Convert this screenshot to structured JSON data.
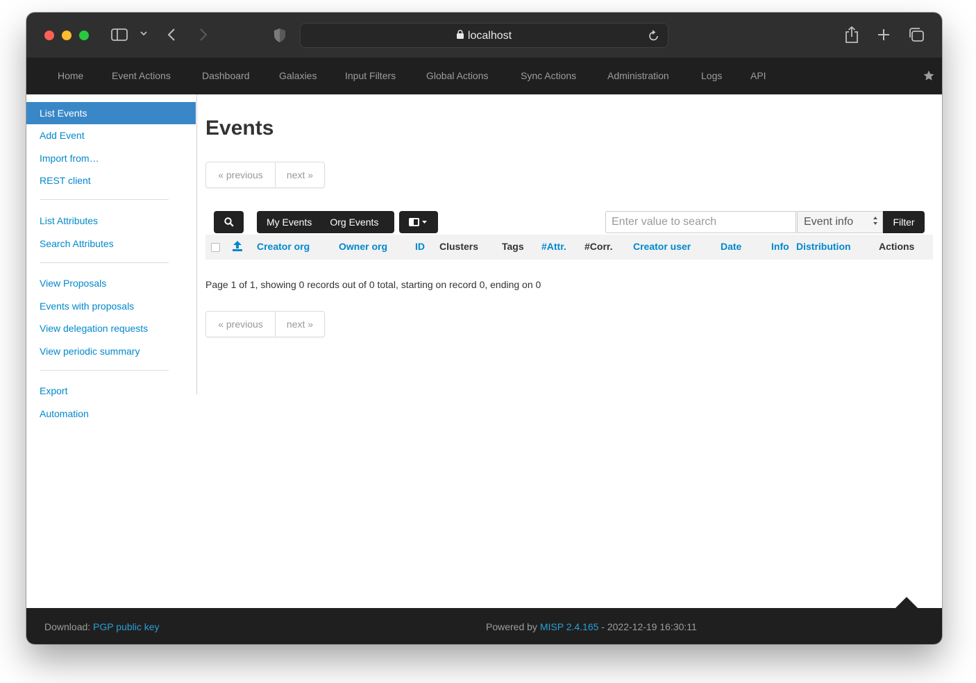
{
  "browser": {
    "url": "localhost"
  },
  "nav": {
    "items": [
      "Home",
      "Event Actions",
      "Dashboard",
      "Galaxies",
      "Input Filters",
      "Global Actions",
      "Sync Actions",
      "Administration",
      "Logs",
      "API"
    ]
  },
  "sidebar": {
    "items": [
      "List Events",
      "Add Event",
      "Import from…",
      "REST client",
      "List Attributes",
      "Search Attributes",
      "View Proposals",
      "Events with proposals",
      "View delegation requests",
      "View periodic summary",
      "Export",
      "Automation"
    ],
    "active_index": 0
  },
  "main": {
    "title": "Events",
    "pager": {
      "previous": "« previous",
      "next": "next »"
    },
    "toolbar": {
      "my_events": "My Events",
      "org_events": "Org Events",
      "search_placeholder": "Enter value to search",
      "search_field": "Event info",
      "filter": "Filter"
    },
    "table": {
      "columns": [
        "Creator org",
        "Owner org",
        "ID",
        "Clusters",
        "Tags",
        "#Attr.",
        "#Corr.",
        "Creator user",
        "Date",
        "Info",
        "Distribution",
        "Actions"
      ]
    },
    "records": "Page 1 of 1, showing 0 records out of 0 total, starting on record 0, ending on 0"
  },
  "footer": {
    "download_label": "Download:",
    "download_link": "PGP public key",
    "powered_by": "Powered by",
    "version_link": "MISP 2.4.165",
    "timestamp": "- 2022-12-19 16:30:11"
  },
  "colors": {
    "navbar": "#1f1f1f",
    "link": "#0088cc",
    "active_sidebar": "#3a87c8"
  }
}
